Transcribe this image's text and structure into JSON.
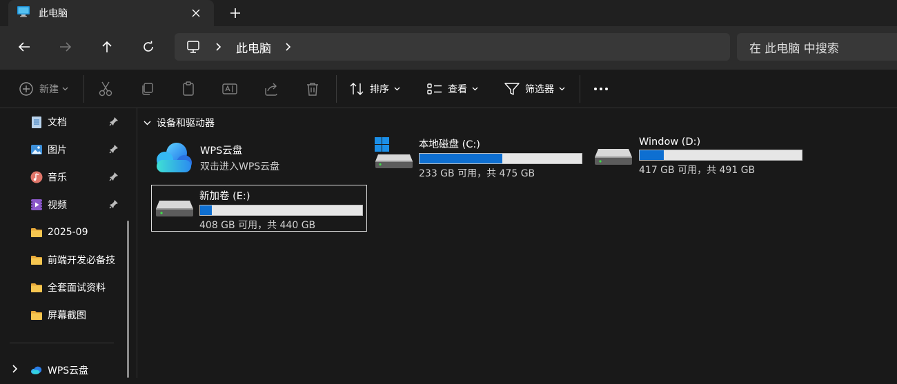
{
  "window": {
    "tab_title": "此电脑"
  },
  "nav": {
    "breadcrumb": "此电脑",
    "search_placeholder": "在 此电脑 中搜索"
  },
  "toolbar": {
    "new_label": "新建",
    "sort_label": "排序",
    "view_label": "查看",
    "filter_label": "筛选器"
  },
  "sidebar": {
    "items": [
      {
        "label": "文档",
        "icon": "document-icon",
        "pinned": true
      },
      {
        "label": "图片",
        "icon": "pictures-icon",
        "pinned": true
      },
      {
        "label": "音乐",
        "icon": "music-icon",
        "pinned": true
      },
      {
        "label": "视频",
        "icon": "video-icon",
        "pinned": true
      },
      {
        "label": "2025-09",
        "icon": "folder-icon",
        "pinned": false
      },
      {
        "label": "前端开发必备技",
        "icon": "folder-icon",
        "pinned": false
      },
      {
        "label": "全套面试资料",
        "icon": "folder-icon",
        "pinned": false
      },
      {
        "label": "屏幕截图",
        "icon": "folder-icon",
        "pinned": false
      }
    ],
    "wps_label": "WPS云盘"
  },
  "main": {
    "section_title": "设备和驱动器",
    "wps": {
      "name": "WPS云盘",
      "subtitle": "双击进入WPS云盘"
    },
    "drives": [
      {
        "name": "本地磁盘 (C:)",
        "info": "233 GB 可用，共 475 GB",
        "used_fraction": 0.509
      },
      {
        "name": "Window (D:)",
        "info": "417 GB 可用，共 491 GB",
        "used_fraction": 0.151
      },
      {
        "name": "新加卷 (E:)",
        "info": "408 GB 可用，共 440 GB",
        "used_fraction": 0.073
      }
    ]
  },
  "colors": {
    "accent": "#0e6fd1",
    "folder": "#f4c24d"
  }
}
